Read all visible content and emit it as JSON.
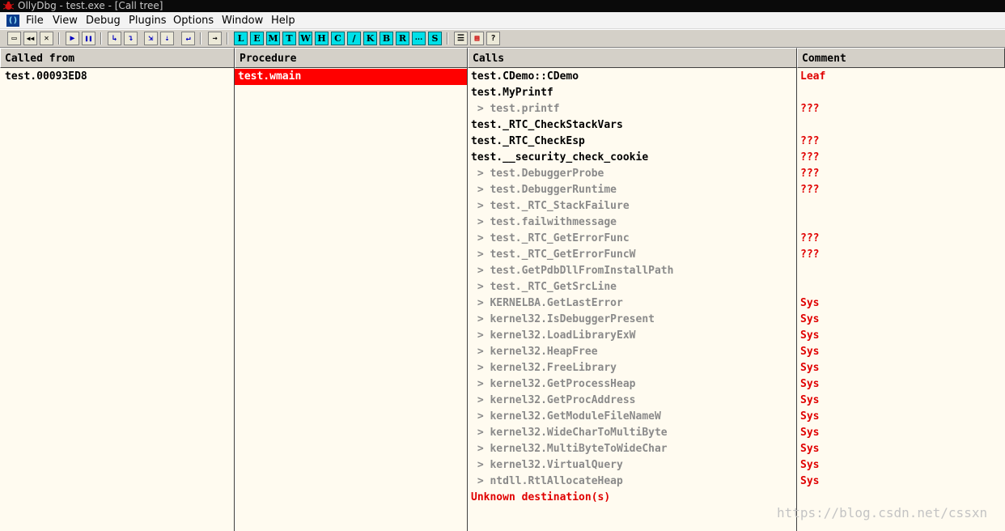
{
  "window": {
    "title": "OllyDbg - test.exe - [Call tree]",
    "icon": "bug-icon"
  },
  "menu": {
    "mdi_icon_label": "()",
    "items": [
      "File",
      "View",
      "Debug",
      "Plugins",
      "Options",
      "Window",
      "Help"
    ]
  },
  "toolbar": {
    "tools": [
      {
        "name": "open-icon",
        "glyph": "▭"
      },
      {
        "name": "restart-icon",
        "glyph": "◀◀"
      },
      {
        "name": "close-icon",
        "glyph": "✕"
      },
      {
        "name": "run-icon",
        "glyph": "▶"
      },
      {
        "name": "pause-icon",
        "glyph": "❚❚"
      },
      {
        "name": "step-into-icon",
        "glyph": "↳"
      },
      {
        "name": "step-over-icon",
        "glyph": "↴"
      },
      {
        "name": "trace-into-icon",
        "glyph": "⇲"
      },
      {
        "name": "trace-over-icon",
        "glyph": "⇣"
      },
      {
        "name": "execute-till-return-icon",
        "glyph": "↵"
      },
      {
        "name": "go-to-icon",
        "glyph": "→"
      }
    ],
    "windows": [
      "L",
      "E",
      "M",
      "T",
      "W",
      "H",
      "C",
      "/",
      "K",
      "B",
      "R",
      "...",
      "S"
    ],
    "extra": [
      {
        "name": "list-icon",
        "glyph": "☰"
      },
      {
        "name": "grid-icon",
        "glyph": "▦"
      },
      {
        "name": "help-icon",
        "glyph": "?"
      }
    ]
  },
  "columns": {
    "called_from": "Called from",
    "procedure": "Procedure",
    "calls": "Calls",
    "comment": "Comment"
  },
  "called_from_rows": [
    "test.00093ED8"
  ],
  "procedure_rows": [
    "test.wmain"
  ],
  "calls": [
    {
      "text": "test.CDemo::CDemo",
      "style": "black",
      "comment": "Leaf"
    },
    {
      "text": "test.MyPrintf",
      "style": "black",
      "comment": ""
    },
    {
      "text": " > test.printf",
      "style": "gray",
      "comment": "???"
    },
    {
      "text": "test._RTC_CheckStackVars",
      "style": "black",
      "comment": ""
    },
    {
      "text": "test._RTC_CheckEsp",
      "style": "black",
      "comment": "???"
    },
    {
      "text": "test.__security_check_cookie",
      "style": "black",
      "comment": "???"
    },
    {
      "text": " > test.DebuggerProbe",
      "style": "gray",
      "comment": "???"
    },
    {
      "text": " > test.DebuggerRuntime",
      "style": "gray",
      "comment": "???"
    },
    {
      "text": " > test._RTC_StackFailure",
      "style": "gray",
      "comment": ""
    },
    {
      "text": " > test.failwithmessage",
      "style": "gray",
      "comment": ""
    },
    {
      "text": " > test._RTC_GetErrorFunc",
      "style": "gray",
      "comment": "???"
    },
    {
      "text": " > test._RTC_GetErrorFuncW",
      "style": "gray",
      "comment": "???"
    },
    {
      "text": " > test.GetPdbDllFromInstallPath",
      "style": "gray",
      "comment": ""
    },
    {
      "text": " > test._RTC_GetSrcLine",
      "style": "gray",
      "comment": ""
    },
    {
      "text": " > KERNELBA.GetLastError",
      "style": "gray",
      "comment": "Sys"
    },
    {
      "text": " > kernel32.IsDebuggerPresent",
      "style": "gray",
      "comment": "Sys"
    },
    {
      "text": " > kernel32.LoadLibraryExW",
      "style": "gray",
      "comment": "Sys"
    },
    {
      "text": " > kernel32.HeapFree",
      "style": "gray",
      "comment": "Sys"
    },
    {
      "text": " > kernel32.FreeLibrary",
      "style": "gray",
      "comment": "Sys"
    },
    {
      "text": " > kernel32.GetProcessHeap",
      "style": "gray",
      "comment": "Sys"
    },
    {
      "text": " > kernel32.GetProcAddress",
      "style": "gray",
      "comment": "Sys"
    },
    {
      "text": " > kernel32.GetModuleFileNameW",
      "style": "gray",
      "comment": "Sys"
    },
    {
      "text": " > kernel32.WideCharToMultiByte",
      "style": "gray",
      "comment": "Sys"
    },
    {
      "text": " > kernel32.MultiByteToWideChar",
      "style": "gray",
      "comment": "Sys"
    },
    {
      "text": " > kernel32.VirtualQuery",
      "style": "gray",
      "comment": "Sys"
    },
    {
      "text": " > ntdll.RtlAllocateHeap",
      "style": "gray",
      "comment": "Sys"
    },
    {
      "text": "Unknown destination(s)",
      "style": "red",
      "comment": ""
    }
  ],
  "watermark": "https://blog.csdn.net/cssxn",
  "colors": {
    "highlight": "#ff0000",
    "comment_red": "#e00000",
    "pane_bg": "#fffbf0",
    "window_button": "#00e0e8"
  }
}
